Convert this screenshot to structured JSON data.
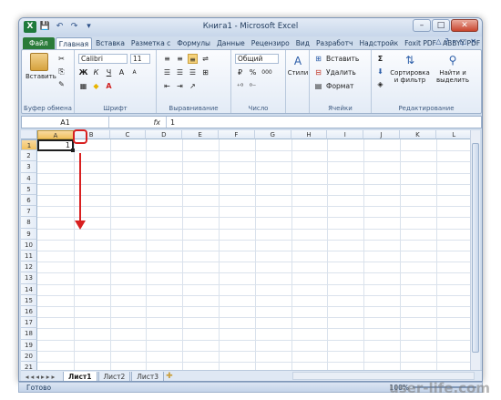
{
  "window": {
    "title": "Книга1  -  Microsoft Excel",
    "app_icon": "X"
  },
  "qat": {
    "save": "💾",
    "undo": "↶",
    "redo": "↷",
    "sep": "▾"
  },
  "tabs": [
    "Файл",
    "Главная",
    "Вставка",
    "Разметка с",
    "Формулы",
    "Данные",
    "Рецензиро",
    "Вид",
    "Разработч",
    "Надстройк",
    "Foxit PDF",
    "ABBYY PDF"
  ],
  "ribbon": {
    "clipboard": {
      "paste": "Вставить",
      "label": "Буфер обмена"
    },
    "font": {
      "name": "Calibri",
      "size": "11",
      "bold": "Ж",
      "italic": "К",
      "underline": "Ч",
      "grow": "A",
      "shrink": "A",
      "label": "Шрифт"
    },
    "align": {
      "label": "Выравнивание"
    },
    "number": {
      "format": "Общий",
      "percent": "%",
      "thousands": "000",
      "label": "Число"
    },
    "styles": {
      "btn": "Стили"
    },
    "cells": {
      "insert": "Вставить",
      "delete": "Удалить",
      "format": "Формат",
      "label": "Ячейки"
    },
    "editing": {
      "sum": "Σ",
      "sort": "Сортировка и фильтр",
      "find": "Найти и выделить",
      "label": "Редактирование"
    }
  },
  "formula": {
    "namebox": "A1",
    "fx": "fx",
    "value": "1"
  },
  "columns": [
    "A",
    "B",
    "C",
    "D",
    "E",
    "F",
    "G",
    "H",
    "I",
    "J",
    "K",
    "L"
  ],
  "rows": [
    "1",
    "2",
    "3",
    "4",
    "5",
    "6",
    "7",
    "8",
    "9",
    "10",
    "11",
    "12",
    "13",
    "14",
    "15",
    "16",
    "17",
    "18",
    "19",
    "20",
    "21"
  ],
  "cells": {
    "A1": "1"
  },
  "sheets": [
    "Лист1",
    "Лист2",
    "Лист3"
  ],
  "status": {
    "mode": "Готово",
    "zoom": "100%"
  },
  "watermark": "user-life.com",
  "colors": {
    "accent": "#2a7b39",
    "annotation": "#d82020"
  }
}
